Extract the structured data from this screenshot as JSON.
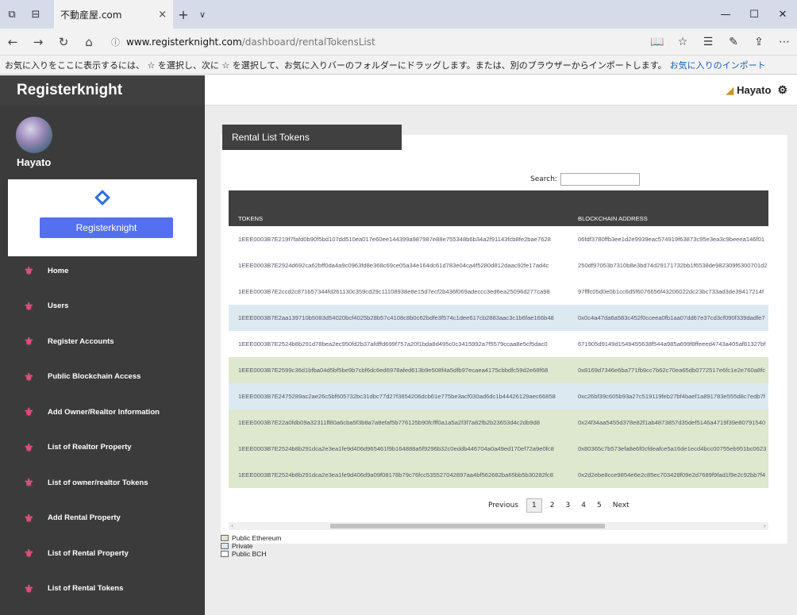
{
  "browser": {
    "tab_title": "不動産屋.com",
    "tab_close": "×",
    "new_tab": "+",
    "tab_dropdown": "∨",
    "url_host": "www.registerknight.com",
    "url_path": "/dashboard/rentalTokensList",
    "favbar_text": "お気に入りをここに表示するには、 ☆ を選択し、次に ☆ を選択して、お気に入りバーのフォルダーにドラッグします。または、別のブラウザーからインポートします。",
    "favbar_link": "お気に入りのインポート"
  },
  "sidebar": {
    "brand": "Registerknight",
    "user_name": "Hayato",
    "brand_button": "Registerknight",
    "items": [
      {
        "label": "Home"
      },
      {
        "label": "Users"
      },
      {
        "label": "Register Accounts"
      },
      {
        "label": "Public Blockchain Access"
      },
      {
        "label": "Add Owner/Realtor Information"
      },
      {
        "label": "List of Realtor Property"
      },
      {
        "label": "List of owner/realtor Tokens"
      },
      {
        "label": "Add Rental Property"
      },
      {
        "label": "List of Rental Property"
      },
      {
        "label": "List of Rental Tokens"
      }
    ]
  },
  "topbar": {
    "user": "Hayato"
  },
  "panel": {
    "title": "Rental List Tokens",
    "search_label": "Search:",
    "columns": [
      "TOKENS",
      "BLOCKCHAIN ADDRESS"
    ],
    "rows": [
      {
        "token": "1EEE0003B7E219f7fafd0b90f5bd107dd510ea017e60ee144399a987987e88e755348b6b34a2f91143fcb8fe2bae7628",
        "address": "06fdf3780ffb3ee1d2e9939eac574919f63873c95e3ea3c9beeea146f01",
        "bg": "#ffffff"
      },
      {
        "token": "1EEE0003B7E2924d692ca62bff0da4a9c0963fd8e368c69ce05a34e164dc61d783e04ca4f5280d812daac92fe17ad4c",
        "address": "250df97053b7310b8e3bd74d29171732bb1f6538de982309f6300701d2",
        "bg": "#ffffff"
      },
      {
        "token": "1EEE0003B7E2ccd2c871b57344fd261130c359cd29c11108938e8e15d7ecf2b436f069adeccc3ed6ea25096d277ca98",
        "address": "97fffc05d0e0b1cc6d5f6076656f43206022dc23bc733ad3de39417214f",
        "bg": "#ffffff"
      },
      {
        "token": "1EEE0003B7E2aa139710b5083d54020bcf4025b28b57c4108c8b0c62bdfe3f574c1dee617cb2883aac3c1b6fae166b48",
        "address": "0x0c4a47da6a583c452f0cceea0fb1aa07dd67e37cd3cf090f339dadfe7",
        "bg": "#dce9f1"
      },
      {
        "token": "1EEE0003B7E2524b8b291d78bea2ec950fd2b37afdffd699f757a20f1bda8d495c0c3415992a7f5579ccaa8e5cf5dac0",
        "address": "671905d9149d1549455638f544a985a699f8ffeeed4743a405af81327bf",
        "bg": "#ffffff"
      },
      {
        "token": "1EEE0003B7E2599c36d1bfba04d5bf5be9b7cbf6dc6ed6978afed613b9e508f4a5dfb97ecaea4175cbbdfc59d2e68f68",
        "address": "0x8169d7346e6ba771fb9cc7b62c70ea65db0772517e6fc1e2e760a8fc",
        "bg": "#dde8cf"
      },
      {
        "token": "1EEE0003B7E2475289ac2ae26c5bf605732bc31dbc77d27f3854206dcb61e775be3acf030ad6dc1b44426129aec66858",
        "address": "0xc26bf39c605b93a27c519119feb27bf4baef1a891783e555d8c7edb7f",
        "bg": "#dce9f1"
      },
      {
        "token": "1EEE0003B7E22a0fdb09a32311ff80a6cba5f3b8a7a8efaf5b776125b90fcfff0a1a5a2f3f7a82fb2b23653d4c2db9d8",
        "address": "0x24f34aa5455d378e82f1ab4873857d35def5146a4719f39e80791540",
        "bg": "#dde8cf"
      },
      {
        "token": "1EEE0003B7E2524b8b291dca2e3ea1fe9d406d965461f9b164888a5f9296b32c0eddb446704a0a49ed170ef72a9e0fc8",
        "address": "0x80365c7b573efa8e6f0cfdeafce5a16de1ecd4bcc00755eb951bc0623",
        "bg": "#dde8cf"
      },
      {
        "token": "1EEE0003B7E2524b8b291dca2e3ea1fe9d406d9a09f08178b79c76fcc535527042897aa4bf562682ba65bb5b30282fc8",
        "address": "0x2d2ebe8cce9854e6e2c85ec703428f09e2d7689f9fad1f9e2c92bb7f4",
        "bg": "#dde8cf"
      }
    ],
    "pager": {
      "previous": "Previous",
      "pages": [
        "1",
        "2",
        "3",
        "4",
        "5"
      ],
      "active": "1",
      "next": "Next"
    },
    "legend": [
      {
        "label": "Public Ethereum",
        "color": "#dde8cf"
      },
      {
        "label": "Private",
        "color": "#dce9f1"
      },
      {
        "label": "Public BCH",
        "color": "#ffffff"
      }
    ]
  }
}
